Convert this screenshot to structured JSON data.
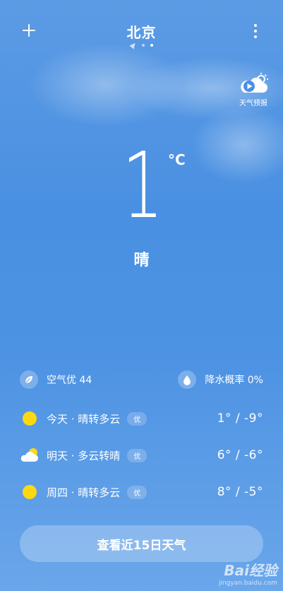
{
  "header": {
    "city": "北京"
  },
  "forecast_video": {
    "label": "天气预报"
  },
  "current": {
    "temperature": "1",
    "unit": "°C",
    "condition": "晴"
  },
  "air_quality": {
    "label": "空气优 44",
    "icon": "leaf-icon"
  },
  "precipitation": {
    "label": "降水概率 0%",
    "icon": "water-drop-icon"
  },
  "days": [
    {
      "label": "今天 · 晴转多云",
      "badge": "优",
      "temp": "1° / -9°",
      "icon": "sun-icon"
    },
    {
      "label": "明天 · 多云转晴",
      "badge": "优",
      "temp": "6° / -6°",
      "icon": "partly-cloudy-icon"
    },
    {
      "label": "周四 · 晴转多云",
      "badge": "优",
      "temp": "8° / -5°",
      "icon": "sun-icon"
    }
  ],
  "button_15day": {
    "label": "查看近15日天气"
  },
  "watermark": {
    "brand": "Bai经验",
    "url": "jingyan.baidu.com"
  },
  "colors": {
    "sky": "#4a90e2",
    "sun": "#ffd814"
  }
}
